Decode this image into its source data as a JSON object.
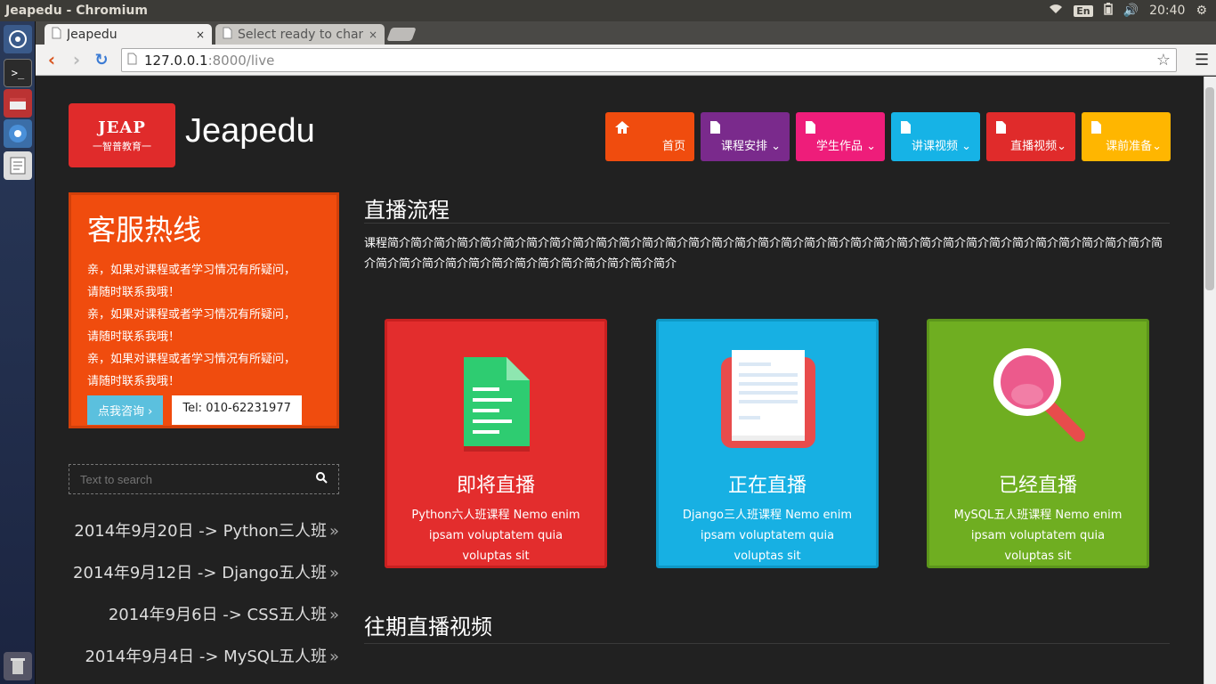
{
  "system": {
    "window_title": "Jeapedu - Chromium",
    "lang_badge": "En",
    "clock": "20:40"
  },
  "browser": {
    "tabs": [
      {
        "label": "Jeapedu",
        "close": "×"
      },
      {
        "label": "Select ready to chang",
        "close": "×"
      }
    ],
    "url_host": "127.0.0.1",
    "url_rest": ":8000/live"
  },
  "site": {
    "logo_text": "JEAP",
    "logo_sub": "一智普教育一",
    "brand": "Jeapedu",
    "nav": [
      {
        "label": "首页",
        "icon": "home-icon",
        "color": "#f04c0e"
      },
      {
        "label": "课程安排",
        "icon": "file-icon",
        "color": "#7a2a8c"
      },
      {
        "label": "学生作品",
        "icon": "file-icon",
        "color": "#ee1d7a"
      },
      {
        "label": "讲课视频",
        "icon": "file-icon",
        "color": "#16b3e6"
      },
      {
        "label": "直播视频",
        "icon": "file-icon",
        "color": "#e02b2b"
      },
      {
        "label": "课前准备",
        "icon": "file-icon",
        "color": "#ffb600"
      }
    ]
  },
  "sidebar": {
    "hotline_title": "客服热线",
    "hotline_lines": [
      "亲，如果对课程或者学习情况有所疑问，",
      "请随时联系我哦！",
      "亲，如果对课程或者学习情况有所疑问，",
      "请随时联系我哦！",
      "亲，如果对课程或者学习情况有所疑问，",
      "请随时联系我哦！"
    ],
    "consult_label": "点我咨询 ›",
    "tel_label": "Tel: 010-62231977",
    "search_placeholder": "Text to search",
    "schedule": [
      "2014年9月20日 -> Python三人班",
      "2014年9月12日 -> Django五人班",
      "2014年9月6日 -> CSS五人班",
      "2014年9月4日 -> MySQL五人班"
    ]
  },
  "main": {
    "live_title": "直播流程",
    "intro": "课程简介简介简介简介简介简介简介简介简介简介简介简介简介简介简介简介简介简介简介简介简介简介简介简介简介简介简介简介简介简介简介简介简介简介简介简介简介简介简介简介简介简介简介简介简介简介简介",
    "cards": [
      {
        "title": "即将直播",
        "line1": "Python六人班课程 Nemo enim",
        "line2": "ipsam voluptatem quia voluptas sit"
      },
      {
        "title": "正在直播",
        "line1": "Django三人班课程 Nemo enim",
        "line2": "ipsam voluptatem quia voluptas sit"
      },
      {
        "title": "已经直播",
        "line1": "MySQL五人班课程  Nemo enim",
        "line2": "ipsam voluptatem quia voluptas sit"
      }
    ],
    "past_title": "往期直播视频"
  }
}
